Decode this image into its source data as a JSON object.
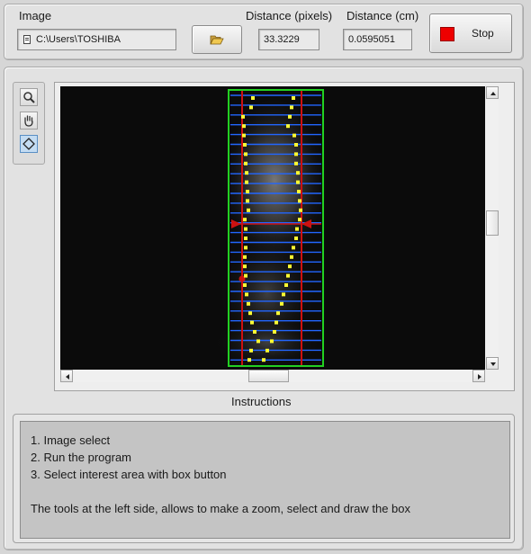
{
  "header": {
    "image_label": "Image",
    "path_value": "C:\\Users\\TOSHIBA",
    "distance_px_label": "Distance (pixels)",
    "distance_px_value": "33.3229",
    "distance_cm_label": "Distance (cm)",
    "distance_cm_value": "0.0595051",
    "stop_label": "Stop"
  },
  "tools": [
    {
      "name": "zoom",
      "icon": "magnifier-icon"
    },
    {
      "name": "pan",
      "icon": "hand-icon"
    },
    {
      "name": "box",
      "icon": "diamond-icon",
      "selected": true
    }
  ],
  "instructions": {
    "title": "Instructions",
    "lines": [
      "1. Image select",
      "2. Run the program",
      "3. Select interest area with box button",
      "",
      "The tools at the left side, allows to make a zoom, select and draw the box"
    ]
  },
  "colors": {
    "roi_box": "#22d022",
    "scan_lines": "#2266ff",
    "edge_lines": "#cc1111",
    "edge_points": "#ffff33",
    "stop_square": "#ee0000"
  }
}
